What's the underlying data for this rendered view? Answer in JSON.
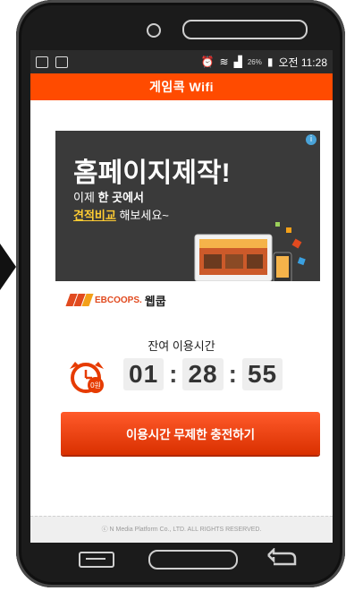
{
  "status_bar": {
    "left_icons": [
      "app-icon",
      "gallery-icon"
    ],
    "right_icons": [
      "alarm-icon",
      "wifi-icon",
      "signal-icon",
      "battery-icon"
    ],
    "battery_percent": "26%",
    "time": "오전 11:28"
  },
  "app": {
    "title": "게임콕 Wifi"
  },
  "ad": {
    "headline": "홈페이지제작!",
    "line1_prefix": "이제 ",
    "line1_bold": "한 곳에서",
    "line2_highlight": "견적비교",
    "line2_suffix": " 해보세요~",
    "brand_name": "EBCOOPS.",
    "brand_korean": "웹쿱",
    "badge": "i"
  },
  "timer": {
    "label": "잔여 이용시간",
    "hours": "01",
    "minutes": "28",
    "seconds": "55",
    "clock_badge": "0원"
  },
  "charge_button": {
    "label": "이용시간 무제한 충전하기"
  },
  "footer": {
    "copyright": "ⓒ N Media Platform Co., LTD. ALL RIGHTS RESERVED."
  },
  "colors": {
    "accent": "#ff4b00",
    "button": "#e63b00"
  }
}
